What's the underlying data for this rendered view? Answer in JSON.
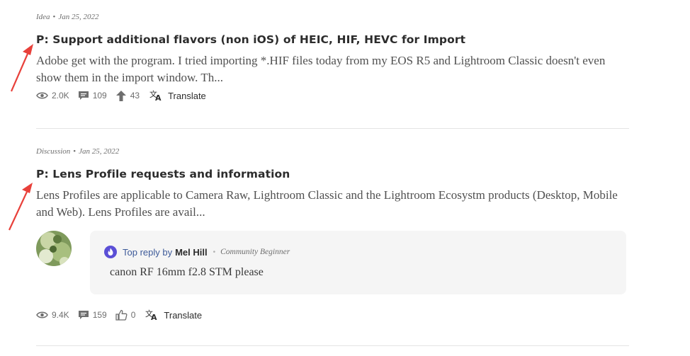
{
  "posts": [
    {
      "type": "Idea",
      "date": "Jan 25, 2022",
      "title": "P: Support additional flavors (non iOS) of HEIC, HIF, HEVC for Import",
      "excerpt": "Adobe get with the program.  I tried importing *.HIF files today from my EOS R5 and Lightroom Classic doesn't even show them in the import window.  Th...",
      "views": "2.0K",
      "comments": "109",
      "votes": "43",
      "translate_label": "Translate"
    },
    {
      "type": "Discussion",
      "date": "Jan 25, 2022",
      "title": "P: Lens Profile requests and information",
      "excerpt": "Lens Profiles are applicable to Camera Raw, Lightroom Classic and the Lightroom Ecosystm products (Desktop, Mobile and Web).   Lens Profiles are avail...",
      "views": "9.4K",
      "comments": "159",
      "likes": "0",
      "translate_label": "Translate",
      "top_reply": {
        "label": "Top reply by",
        "user": "Mel Hill",
        "rank": "Community Beginner",
        "text": "canon RF 16mm f2.8 STM please"
      }
    }
  ],
  "colors": {
    "annotation_arrow": "#e8403a",
    "reply_label": "#3d5a99",
    "rank_badge": "#5b4fd6",
    "reply_bg": "#f5f5f5"
  },
  "icons": [
    "eye-icon",
    "comment-icon",
    "upvote-arrow-icon",
    "thumbs-up-icon",
    "translate-icon",
    "rank-badge-icon"
  ]
}
